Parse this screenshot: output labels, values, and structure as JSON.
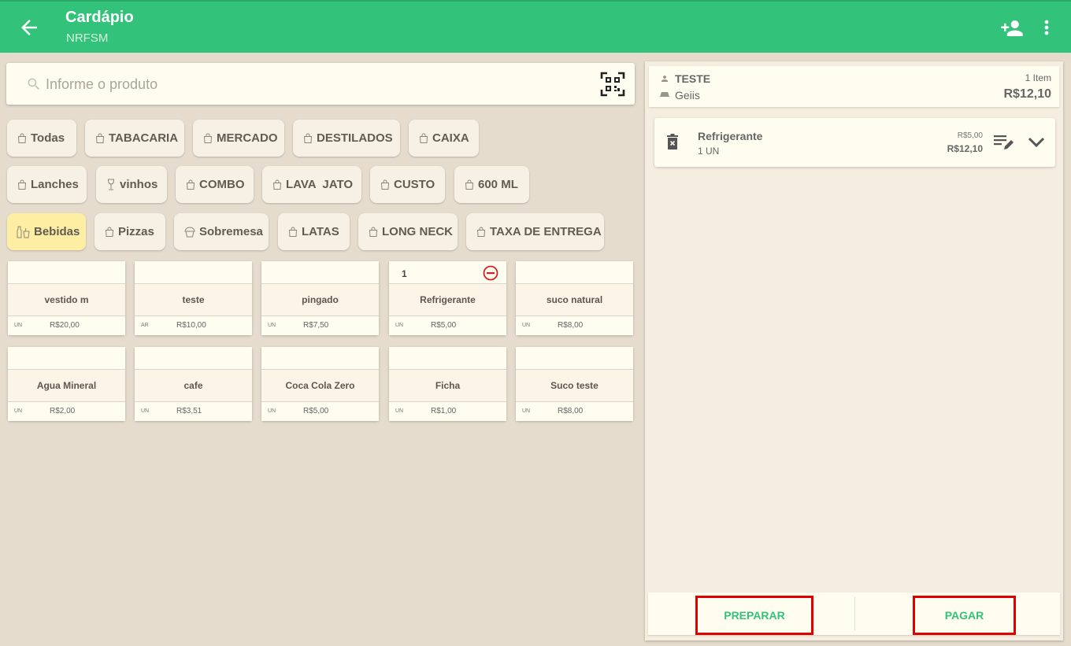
{
  "header": {
    "title": "Cardápio",
    "subtitle": "NRFSM"
  },
  "search": {
    "placeholder": "Informe o produto",
    "value": ""
  },
  "categories": [
    {
      "label": "Todas",
      "active": false
    },
    {
      "label": "TABACARIA",
      "active": false
    },
    {
      "label": "MERCADO",
      "active": false
    },
    {
      "label": "DESTILADOS",
      "active": false
    },
    {
      "label": "CAIXA",
      "active": false
    },
    {
      "label": "Lanches",
      "active": false
    },
    {
      "label": "vinhos",
      "active": false
    },
    {
      "label": "COMBO",
      "active": false
    },
    {
      "label": "LAVA  JATO",
      "active": false
    },
    {
      "label": "CUSTO",
      "active": false
    },
    {
      "label": "600 ML",
      "active": false
    },
    {
      "label": "Bebidas",
      "active": true
    },
    {
      "label": "Pizzas",
      "active": false
    },
    {
      "label": "Sobremesa",
      "active": false
    },
    {
      "label": "LATAS",
      "active": false
    },
    {
      "label": "LONG NECK",
      "active": false
    },
    {
      "label": "TAXA DE ENTREGA",
      "active": false
    }
  ],
  "products": [
    {
      "name": "vestido m",
      "unit": "UN",
      "price": "R$20,00",
      "qty": ""
    },
    {
      "name": "teste",
      "unit": "AR",
      "price": "R$10,00",
      "qty": ""
    },
    {
      "name": "pingado",
      "unit": "UN",
      "price": "R$7,50",
      "qty": ""
    },
    {
      "name": "Refrigerante",
      "unit": "UN",
      "price": "R$5,00",
      "qty": "1"
    },
    {
      "name": "suco natural",
      "unit": "UN",
      "price": "R$8,00",
      "qty": ""
    },
    {
      "name": "Agua Mineral",
      "unit": "UN",
      "price": "R$2,00",
      "qty": ""
    },
    {
      "name": "cafe",
      "unit": "UN",
      "price": "R$3,51",
      "qty": ""
    },
    {
      "name": "Coca Cola Zero",
      "unit": "UN",
      "price": "R$5,00",
      "qty": ""
    },
    {
      "name": "Ficha",
      "unit": "UN",
      "price": "R$1,00",
      "qty": ""
    },
    {
      "name": "Suco teste",
      "unit": "UN",
      "price": "R$8,00",
      "qty": ""
    }
  ],
  "order": {
    "client": "TESTE",
    "place": "Geiis",
    "item_count": "1 Item",
    "total": "R$12,10",
    "items": [
      {
        "name": "Refrigerante",
        "qty": "1 UN",
        "unit_price": "R$5,00",
        "total": "R$12,10"
      }
    ]
  },
  "actions": {
    "prepare_label": "PREPARAR",
    "pay_label": "PAGAR"
  },
  "colors": {
    "primary": "#33c279",
    "background": "#e5dccd",
    "chip_active": "#fdeea4",
    "highlight_border": "#e00000"
  }
}
